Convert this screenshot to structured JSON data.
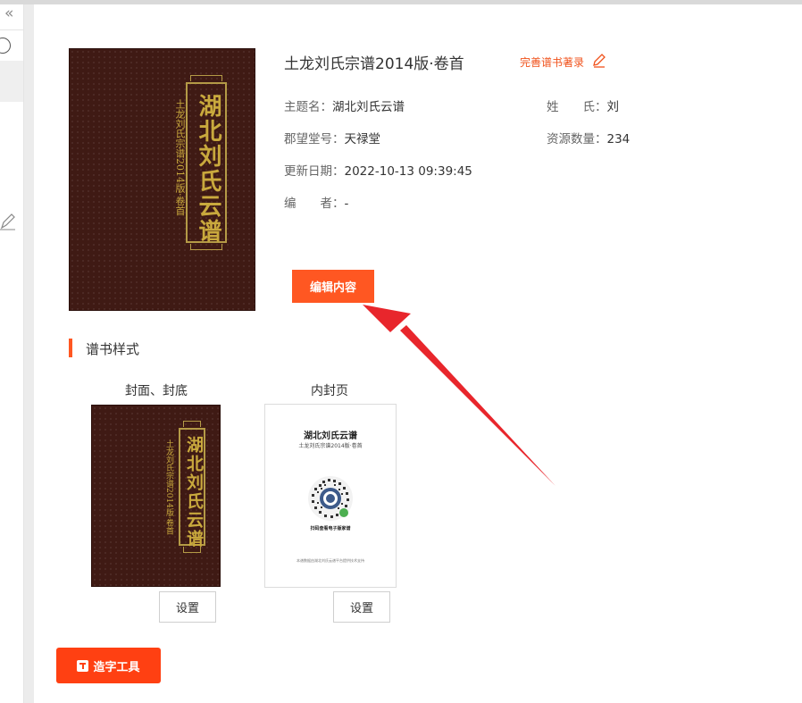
{
  "sidebar": {
    "collapse_icon": "double-chevron-left-icon"
  },
  "book": {
    "title": "土龙刘氏宗谱2014版·卷首",
    "perfect_link": "完善谱书著录",
    "fields": [
      {
        "label": "主题名：",
        "value": "湖北刘氏云谱"
      },
      {
        "label": "姓　　氏：",
        "value": "刘"
      },
      {
        "label": "郡望堂号：",
        "value": "天禄堂"
      },
      {
        "label": "资源数量：",
        "value": "234"
      },
      {
        "label": "更新日期：",
        "value": "2022-10-13 09:39:45"
      },
      {
        "label": "编　　者：",
        "value": "-"
      }
    ],
    "edit_button": "编辑内容"
  },
  "cover": {
    "main_title": "湖北刘氏云谱",
    "sub_title": "土龙刘氏宗谱2014版·卷首"
  },
  "styles_section": {
    "title": "谱书样式",
    "items": [
      {
        "label": "封面、封底",
        "button": "设置"
      },
      {
        "label": "内封页",
        "button": "设置"
      }
    ]
  },
  "inner_page": {
    "title": "湖北刘氏云谱",
    "subtitle": "土龙刘氏宗谱2014版·卷首",
    "qr_label": "扫码查看电子版家谱",
    "footer": "本谱数据由湖北刘氏云谱平台提供技术支持"
  },
  "tool_button": "造字工具",
  "colors": {
    "accent": "#ff5722",
    "cover_bg": "#3f1a14",
    "gold": "#c9a93d",
    "arrow": "#e8262c"
  }
}
